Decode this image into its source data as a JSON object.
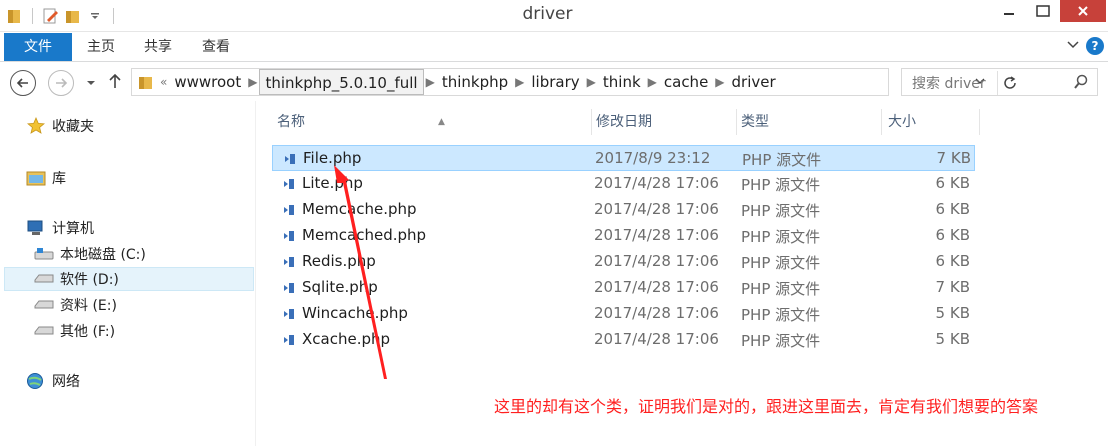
{
  "window": {
    "title": "driver",
    "help_glyph": "?"
  },
  "ribbon": {
    "tabs": [
      "文件",
      "主页",
      "共享",
      "查看"
    ]
  },
  "address": {
    "breadcrumbs": [
      "wwwroot",
      "thinkphp_5.0.10_full",
      "thinkphp",
      "library",
      "think",
      "cache",
      "driver"
    ],
    "overflow_glyph": "«",
    "selected_crumb": "thinkphp_5.0.10_full"
  },
  "search": {
    "placeholder": "搜索 driver"
  },
  "nav": {
    "favorites": "收藏夹",
    "libraries": "库",
    "computer": "计算机",
    "drives": [
      {
        "label": "本地磁盘 (C:)",
        "selected": false
      },
      {
        "label": "软件 (D:)",
        "selected": true
      },
      {
        "label": "资料 (E:)",
        "selected": false
      },
      {
        "label": "其他 (F:)",
        "selected": false
      }
    ],
    "network": "网络"
  },
  "columns": {
    "name": "名称",
    "date": "修改日期",
    "type": "类型",
    "size": "大小"
  },
  "files": [
    {
      "name": "File.php",
      "date": "2017/8/9 23:12",
      "type": "PHP 源文件",
      "size": "7 KB",
      "selected": true
    },
    {
      "name": "Lite.php",
      "date": "2017/4/28 17:06",
      "type": "PHP 源文件",
      "size": "6 KB"
    },
    {
      "name": "Memcache.php",
      "date": "2017/4/28 17:06",
      "type": "PHP 源文件",
      "size": "6 KB"
    },
    {
      "name": "Memcached.php",
      "date": "2017/4/28 17:06",
      "type": "PHP 源文件",
      "size": "6 KB"
    },
    {
      "name": "Redis.php",
      "date": "2017/4/28 17:06",
      "type": "PHP 源文件",
      "size": "6 KB"
    },
    {
      "name": "Sqlite.php",
      "date": "2017/4/28 17:06",
      "type": "PHP 源文件",
      "size": "7 KB"
    },
    {
      "name": "Wincache.php",
      "date": "2017/4/28 17:06",
      "type": "PHP 源文件",
      "size": "5 KB"
    },
    {
      "name": "Xcache.php",
      "date": "2017/4/28 17:06",
      "type": "PHP 源文件",
      "size": "5 KB"
    }
  ],
  "annotation": {
    "text": "这里的却有这个类，证明我们是对的，跟进这里面去，肯定有我们想要的答案",
    "color": "#ff2020"
  },
  "colors": {
    "accent": "#1979ca",
    "selection": "#cce8ff",
    "close": "#c7413a"
  }
}
